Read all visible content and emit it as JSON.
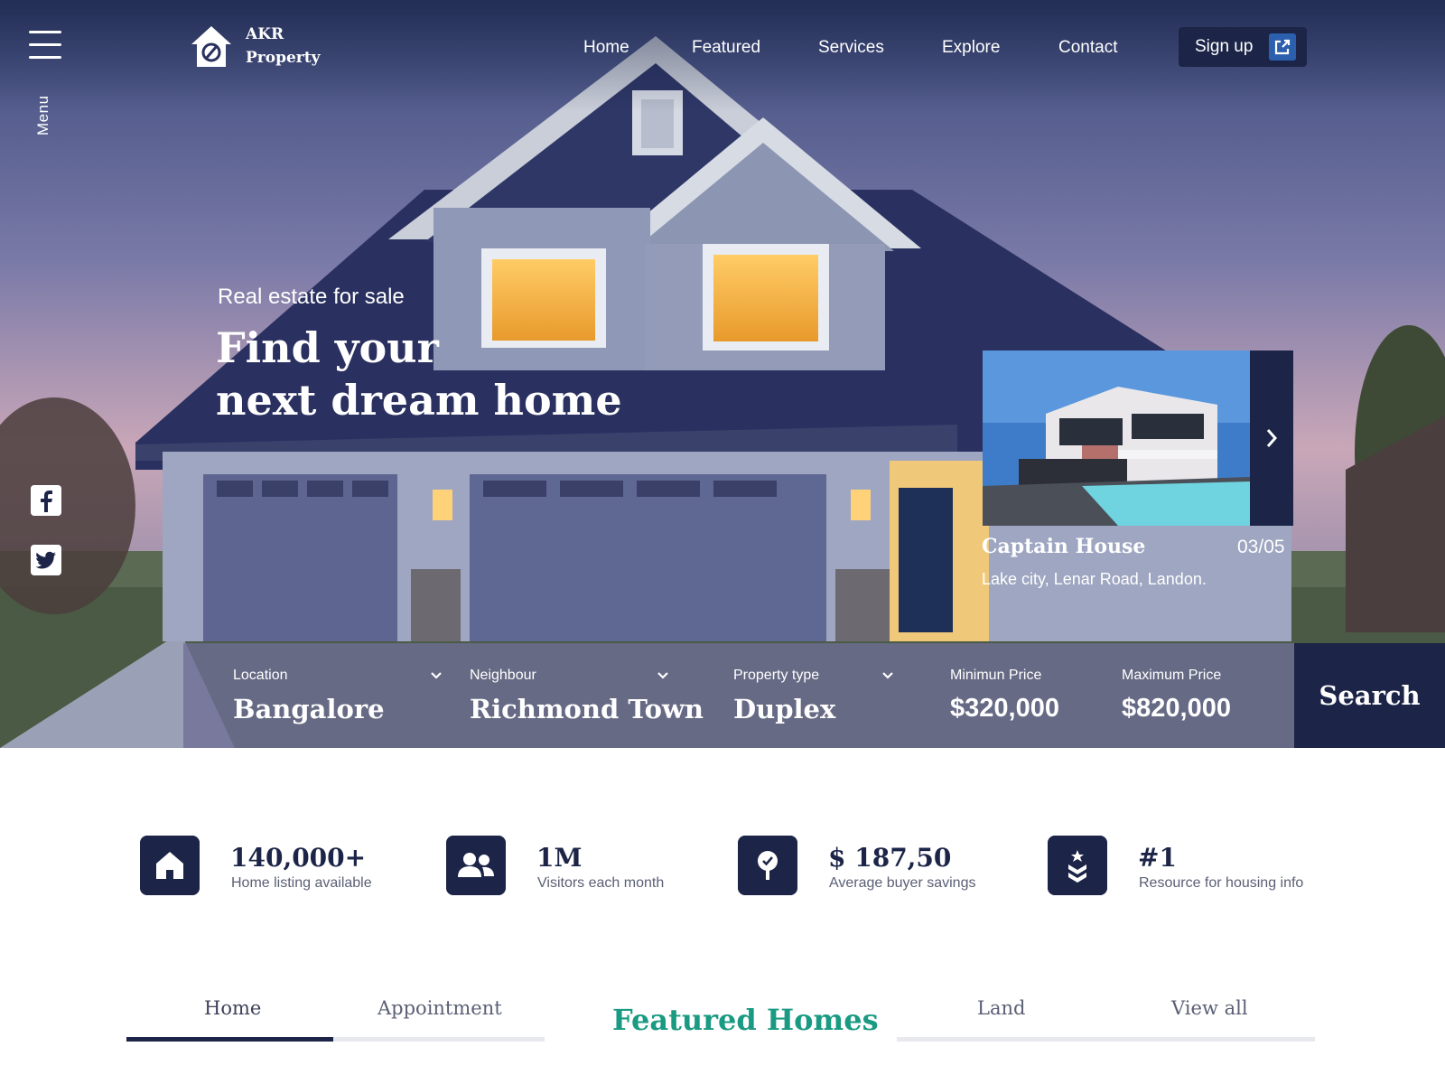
{
  "brand": {
    "line1": "AKR",
    "line2": "Property"
  },
  "menu_label": "Menu",
  "nav": {
    "items": [
      "Home",
      "Featured",
      "Services",
      "Explore",
      "Contact"
    ],
    "signup_label": "Sign up"
  },
  "hero": {
    "kicker": "Real estate for sale",
    "headline_line1": "Find your",
    "headline_line2": "next dream home"
  },
  "featured_card": {
    "title": "Captain House",
    "counter": "03/05",
    "address": "Lake city, Lenar Road, Landon."
  },
  "search": {
    "fields": [
      {
        "label": "Location",
        "value": "Bangalore",
        "dropdown": true
      },
      {
        "label": "Neighbour",
        "value": "Richmond Town",
        "dropdown": true
      },
      {
        "label": "Property type",
        "value": "Duplex",
        "dropdown": true
      },
      {
        "label": "Minimun Price",
        "value": "$320,000",
        "dropdown": false
      },
      {
        "label": "Maximum Price",
        "value": "$820,000",
        "dropdown": false
      }
    ],
    "button_label": "Search"
  },
  "stats": [
    {
      "icon": "home-icon",
      "value": "140,000+",
      "label": "Home listing available"
    },
    {
      "icon": "users-icon",
      "value": "1M",
      "label": "Visitors each month"
    },
    {
      "icon": "savings-icon",
      "value": "$ 187,50",
      "label": "Average buyer savings"
    },
    {
      "icon": "badge-icon",
      "value": "#1",
      "label": "Resource for housing info"
    }
  ],
  "tabs": {
    "items": [
      "Home",
      "Appointment",
      "Land",
      "View all"
    ],
    "active": "Home",
    "section_title": "Featured Homes"
  },
  "colors": {
    "navy": "#1c2548",
    "accent_blue": "#2c5fae",
    "teal": "#1a9a82",
    "muted_text": "#5a6075"
  }
}
